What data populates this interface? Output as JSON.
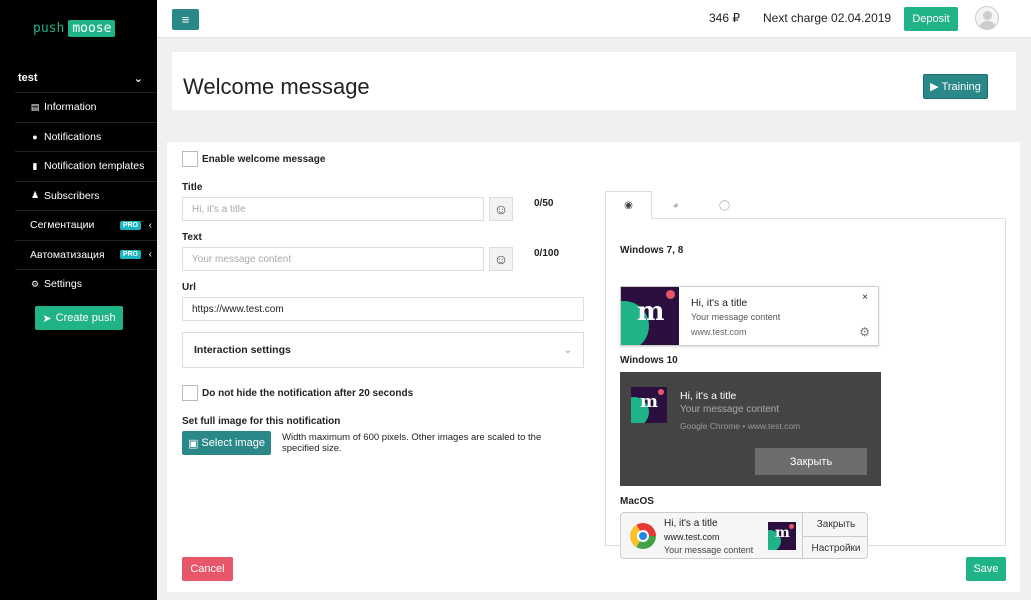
{
  "brand": {
    "part1": "push",
    "part2": "moose"
  },
  "project": {
    "name": "test"
  },
  "sidebar": {
    "items": [
      {
        "label": "Information",
        "icon": "info-card-icon"
      },
      {
        "label": "Notifications",
        "icon": "comment-icon"
      },
      {
        "label": "Notification templates",
        "icon": "file-icon"
      },
      {
        "label": "Subscribers",
        "icon": "user-icon"
      },
      {
        "label": "Сегментации",
        "badge": "PRO"
      },
      {
        "label": "Автоматизация",
        "badge": "PRO"
      },
      {
        "label": "Settings",
        "icon": "gear-icon"
      }
    ],
    "create_push": "Create push"
  },
  "topbar": {
    "balance": "346 ₽",
    "next_charge": "Next charge 02.04.2019",
    "deposit": "Deposit"
  },
  "header": {
    "title": "Welcome message",
    "training": "Training"
  },
  "form": {
    "enable_label": "Enable welcome message",
    "title_label": "Title",
    "title_placeholder": "Hi, it's a title",
    "title_counter": "0/50",
    "text_label": "Text",
    "text_placeholder": "Your message content",
    "text_counter": "0/100",
    "url_label": "Url",
    "url_value": "https://www.test.com",
    "interaction_settings": "Interaction settings",
    "no_hide_label": "Do not hide the notification after 20 seconds",
    "image_label": "Set full image for this notification",
    "select_image": "Select image",
    "image_help": "Width maximum of 600 pixels. Other images are scaled to the specified size.",
    "cancel": "Cancel",
    "save": "Save"
  },
  "preview": {
    "tabs": [
      "chrome-icon",
      "firefox-icon",
      "opera-icon"
    ],
    "windows78": {
      "label": "Windows 7, 8",
      "title": "Hi, it's a title",
      "text": "Your message content",
      "site": "www.test.com",
      "close": "×"
    },
    "windows10": {
      "label": "Windows 10",
      "title": "Hi, it's a title",
      "text": "Your message content",
      "site": "Google Chrome • www.test.com",
      "close": "Закрыть"
    },
    "macos": {
      "label": "MacOS",
      "title": "Hi, it's a title",
      "site": "www.test.com",
      "text": "Your message content",
      "close": "Закрыть",
      "settings": "Настройки"
    }
  },
  "colors": {
    "green": "#1fb387",
    "teal": "#2b8888",
    "red": "#e8566a",
    "pro": "#1ab5c1"
  }
}
